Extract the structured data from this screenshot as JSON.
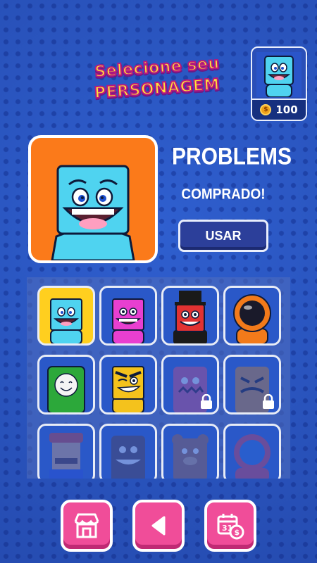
{
  "header": {
    "title_line1": "Selecione seu",
    "title_line2": "PERSONAGEM"
  },
  "wallet": {
    "coins": "100",
    "coin_icon": "coin-icon",
    "current_avatar": "cyan-square-head"
  },
  "selected_character": {
    "name": "PROBLEMS",
    "status": "COMPRADO!",
    "use_label": "USAR",
    "background_color": "#fb7a1a"
  },
  "characters": [
    {
      "id": "problems",
      "color": "#4fd3f0",
      "locked": false,
      "selected": true
    },
    {
      "id": "pink",
      "color": "#e83fd0",
      "locked": false,
      "selected": false
    },
    {
      "id": "red-tophat",
      "color": "#e23232",
      "locked": false,
      "selected": false
    },
    {
      "id": "astronaut-orange",
      "color": "#f27a1a",
      "locked": false,
      "selected": false
    },
    {
      "id": "green-smile",
      "color": "#2ca83a",
      "locked": false,
      "selected": false
    },
    {
      "id": "yellow-wink",
      "color": "#f4c21c",
      "locked": false,
      "selected": false
    },
    {
      "id": "pink-monster",
      "color": "#e04a78",
      "locked": true,
      "selected": false
    },
    {
      "id": "orange-angry",
      "color": "#e0881c",
      "locked": true,
      "selected": false
    },
    {
      "id": "plumber",
      "color": "#d83a2a",
      "locked": true,
      "selected": false
    },
    {
      "id": "dark-grin",
      "color": "#5a3a3a",
      "locked": true,
      "selected": false
    },
    {
      "id": "bear",
      "color": "#a8623a",
      "locked": true,
      "selected": false
    },
    {
      "id": "astronaut-red",
      "color": "#e03a4a",
      "locked": true,
      "selected": false
    }
  ],
  "bottom_nav": {
    "store_icon": "store-icon",
    "back_icon": "back-arrow-icon",
    "calendar_icon": "calendar-coin-icon"
  },
  "colors": {
    "background": "#2f5fcf",
    "accent_pink": "#f04d99",
    "title_yellow": "#ffe23a",
    "button_navy": "#2c3f9a"
  }
}
